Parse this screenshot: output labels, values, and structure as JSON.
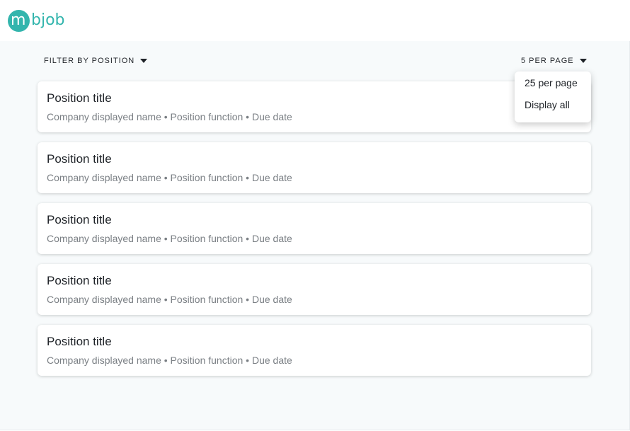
{
  "brand": {
    "logo_initial": "m",
    "logo_rest": "bjob",
    "color": "#33b5ad"
  },
  "toolbar": {
    "filter_label": "FILTER BY POSITION",
    "per_page_label": "5 PER PAGE"
  },
  "dropdown": {
    "options": [
      "25 per page",
      "Display all"
    ]
  },
  "positions": [
    {
      "title": "Position title",
      "subtitle": "Company displayed name • Position function • Due date"
    },
    {
      "title": "Position title",
      "subtitle": "Company displayed name • Position function • Due date"
    },
    {
      "title": "Position title",
      "subtitle": "Company displayed name • Position function • Due date"
    },
    {
      "title": "Position title",
      "subtitle": "Company displayed name • Position function • Due date"
    },
    {
      "title": "Position title",
      "subtitle": "Company displayed name • Position function • Due date"
    }
  ]
}
